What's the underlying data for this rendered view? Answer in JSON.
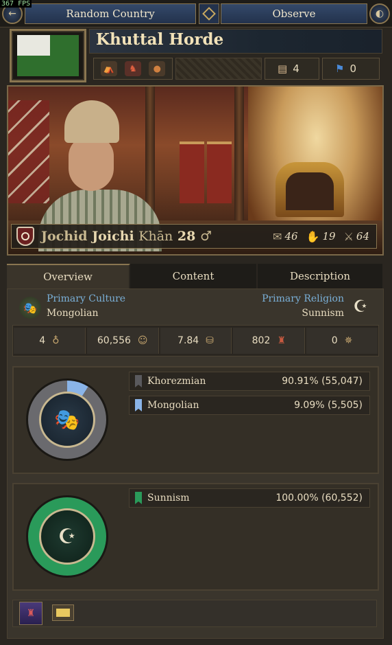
{
  "fps": "367 FPS",
  "topbar": {
    "random_label": "Random Country",
    "observe_label": "Observe"
  },
  "country": {
    "name": "Khuttal Horde",
    "flag_colors": {
      "field": "#2f6f2d",
      "canton": "#e8e8e0"
    },
    "chip_stat_1": "4",
    "chip_stat_2": "0"
  },
  "ruler": {
    "dynasty": "Jochid",
    "name": "Joichi",
    "title": "Khān",
    "age": "28",
    "gender_symbol": "♂",
    "admin": "46",
    "diplomatic": "19",
    "military": "64"
  },
  "tabs": [
    "Overview",
    "Content",
    "Description"
  ],
  "overview": {
    "culture_label": "Primary Culture",
    "culture_value": "Mongolian",
    "religion_label": "Primary Religion",
    "religion_value": "Sunnism",
    "stats": [
      "4",
      "60,556",
      "7.84",
      "802",
      "0"
    ]
  },
  "culture_breakdown": [
    {
      "name": "Khorezmian",
      "pct": "90.91% (55,047)",
      "color": "#5a5a5e"
    },
    {
      "name": "Mongolian",
      "pct": "9.09% (5,505)",
      "color": "#8ab4e8"
    }
  ],
  "religion_breakdown": [
    {
      "name": "Sunnism",
      "pct": "100.00% (60,552)",
      "color": "#2a9a5a"
    }
  ],
  "colors": {
    "accent_gold": "#8a7650",
    "link_blue": "#7ab0d8",
    "religion_green": "#2a9a5a"
  }
}
